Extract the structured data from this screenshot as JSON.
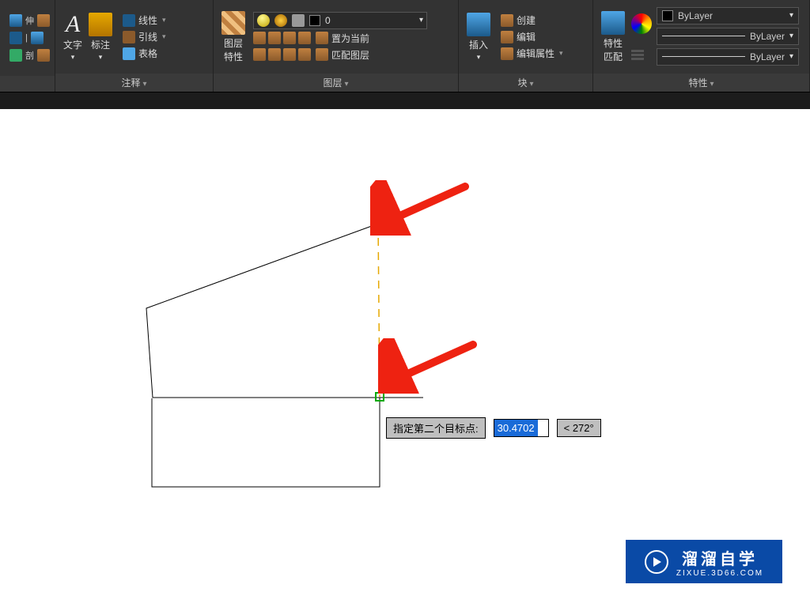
{
  "ribbon": {
    "leftedge": {
      "row1": "伸",
      "row2": "|",
      "row3": "剖"
    },
    "annotate": {
      "text_label": "文字",
      "dim_label": "标注",
      "line_label": "线性",
      "leader_label": "引线",
      "table_label": "表格",
      "panel_title": "注释"
    },
    "layers": {
      "props_label": "图层\n特性",
      "set_current": "置为当前",
      "match_layer": "匹配图层",
      "dropdown_value": "0",
      "panel_title": "图层"
    },
    "blocks": {
      "insert_label": "插入",
      "create": "创建",
      "edit": "编辑",
      "edit_attr": "编辑属性",
      "panel_title": "块"
    },
    "props": {
      "match_label": "特性\n匹配",
      "bylayer": "ByLayer",
      "panel_title": "特性"
    }
  },
  "dyn": {
    "prompt": "指定第二个目标点:",
    "dist": "30.4702",
    "angle": "< 272°"
  },
  "watermark": {
    "main": "溜溜自学",
    "sub": "ZIXUE.3D66.COM"
  }
}
